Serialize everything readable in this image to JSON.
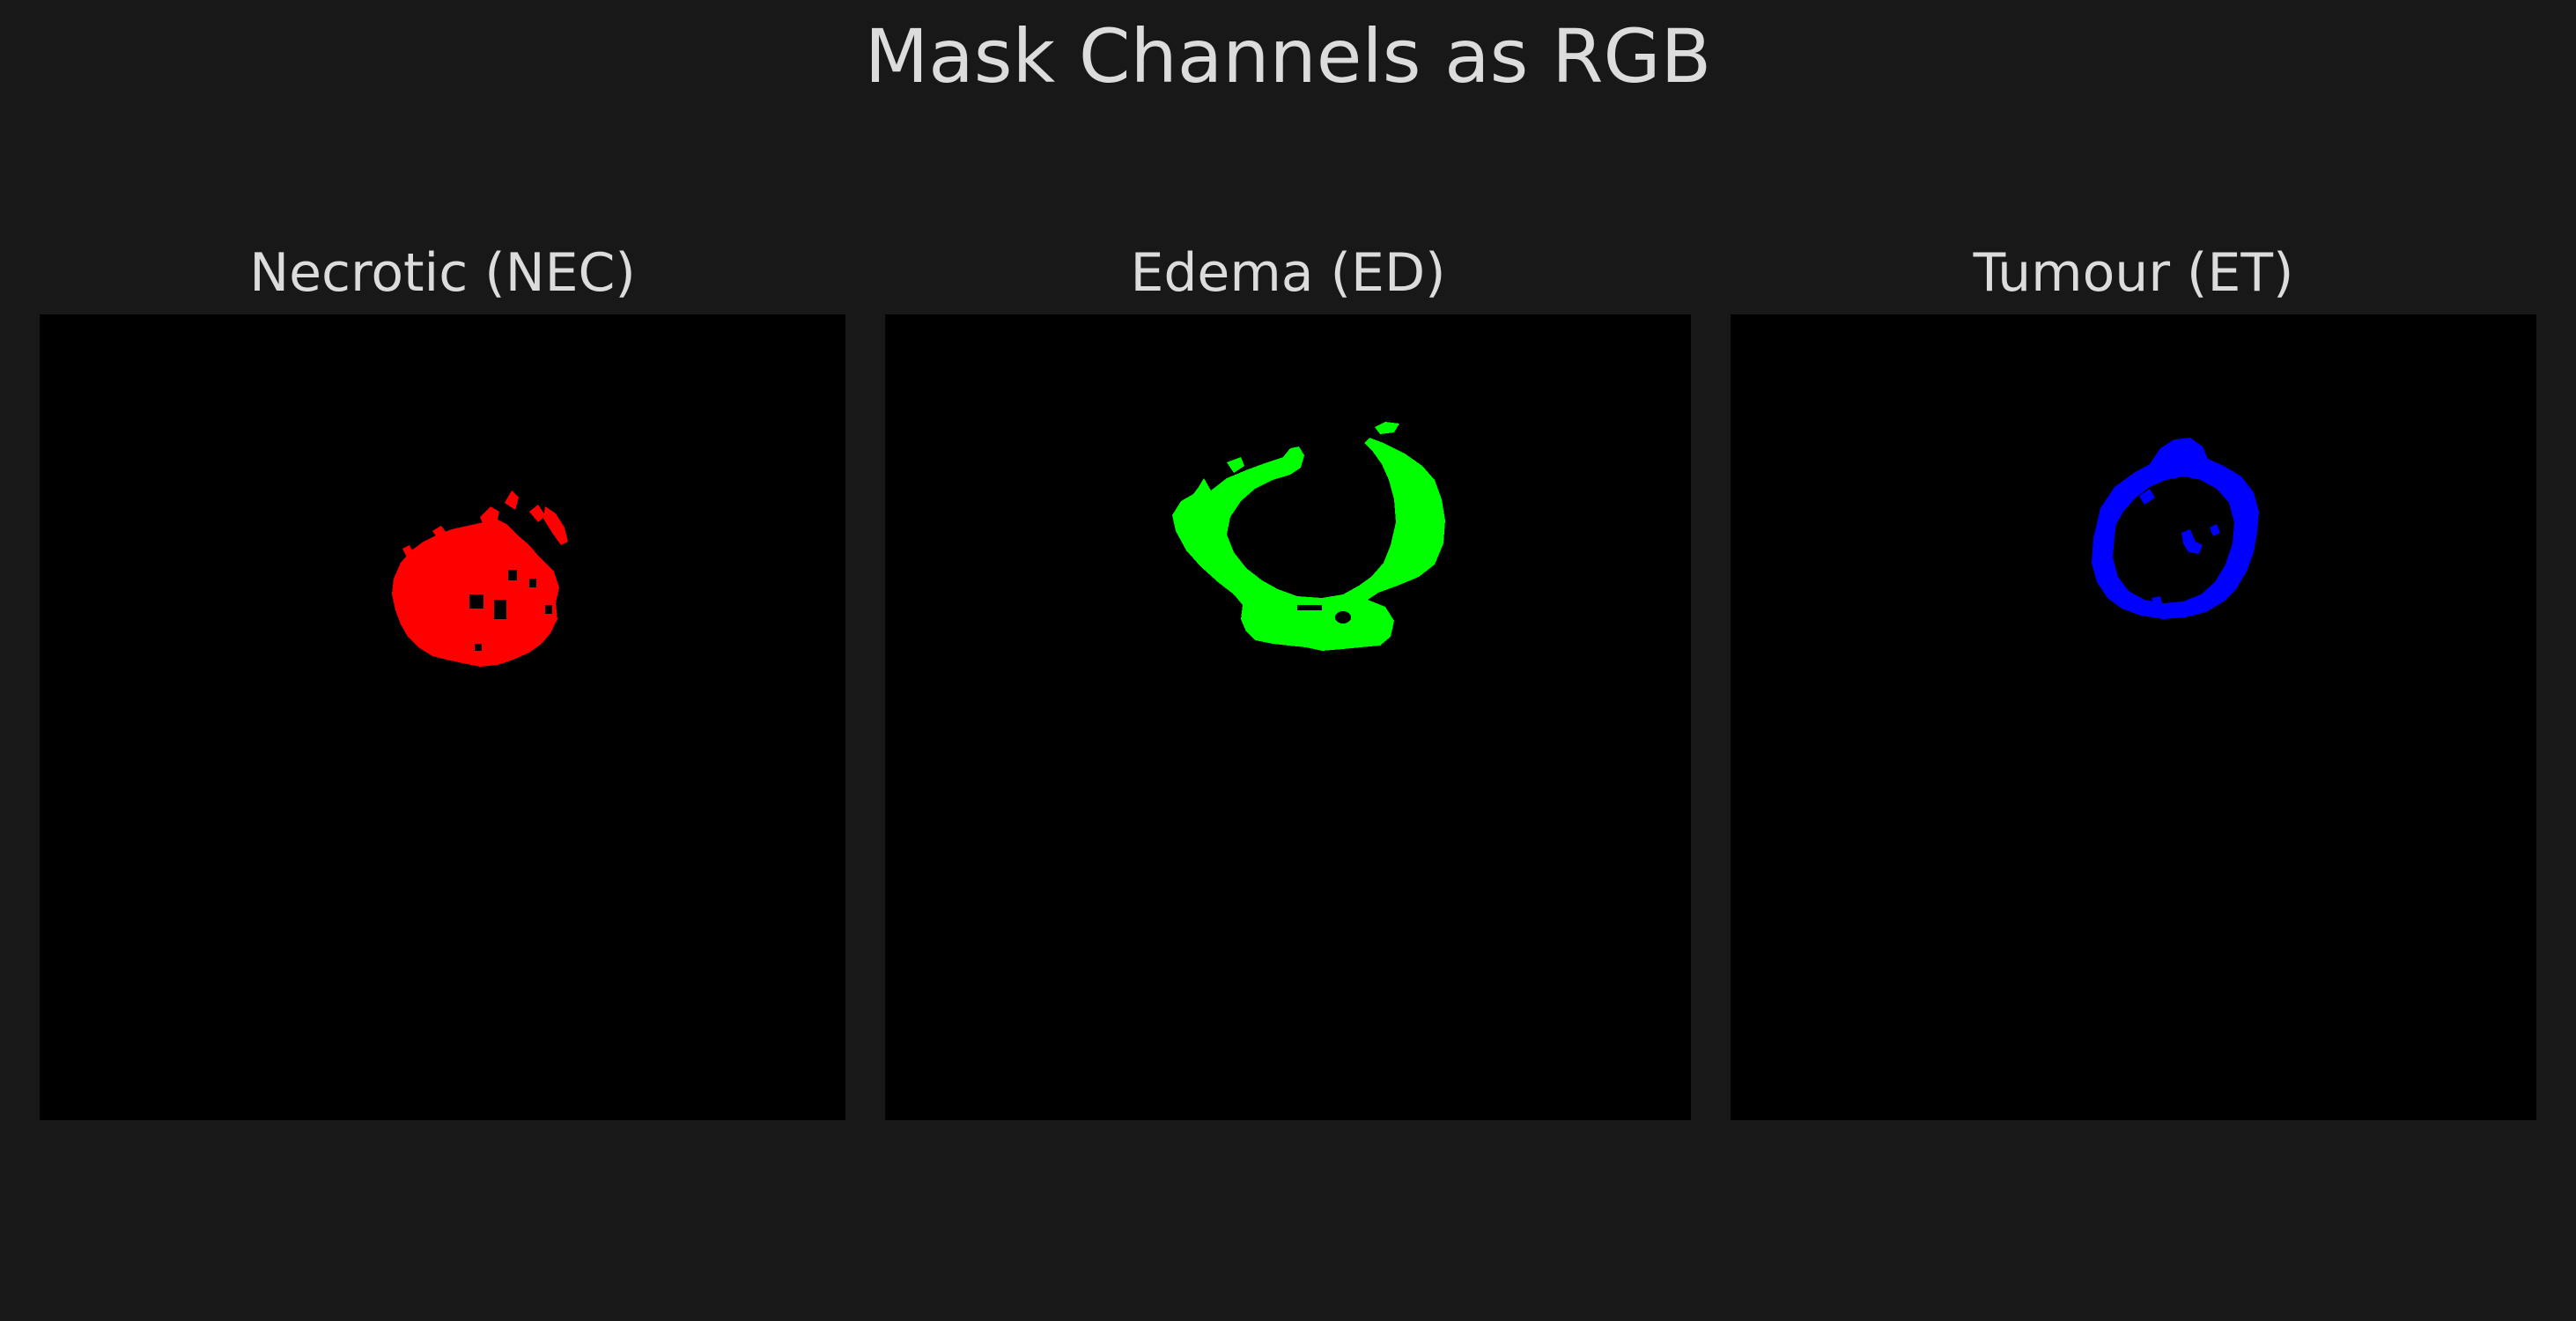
{
  "figure": {
    "title": "Mask Channels as RGB"
  },
  "panels": [
    {
      "title": "Necrotic (NEC)",
      "channel_color": "#ff0000"
    },
    {
      "title": "Edema (ED)",
      "channel_color": "#00ff00"
    },
    {
      "title": "Tumour (ET)",
      "channel_color": "#0000ff"
    }
  ],
  "colors": {
    "figure_background": "#181818",
    "panel_background": "#000000",
    "text": "#dcdcdc"
  }
}
